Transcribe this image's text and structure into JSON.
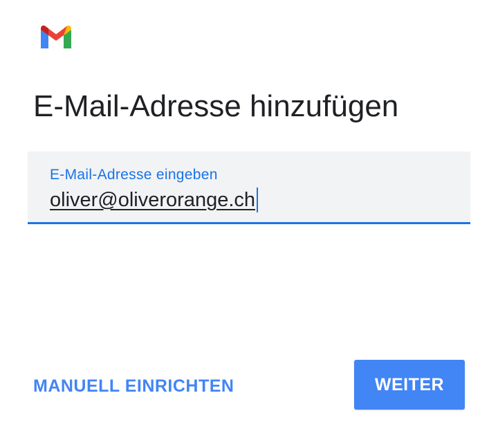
{
  "app": {
    "logo_icon": "gmail-icon"
  },
  "page": {
    "title": "E-Mail-Adresse hinzufügen"
  },
  "email_field": {
    "label": "E-Mail-Adresse eingeben",
    "value": "oliver@oliverorange.ch"
  },
  "actions": {
    "manual_setup_label": "MANUELL EINRICHTEN",
    "next_label": "WEITER"
  },
  "colors": {
    "accent": "#1a73e8",
    "button": "#4285f4",
    "field_bg": "#f1f3f4",
    "text": "#202124"
  }
}
